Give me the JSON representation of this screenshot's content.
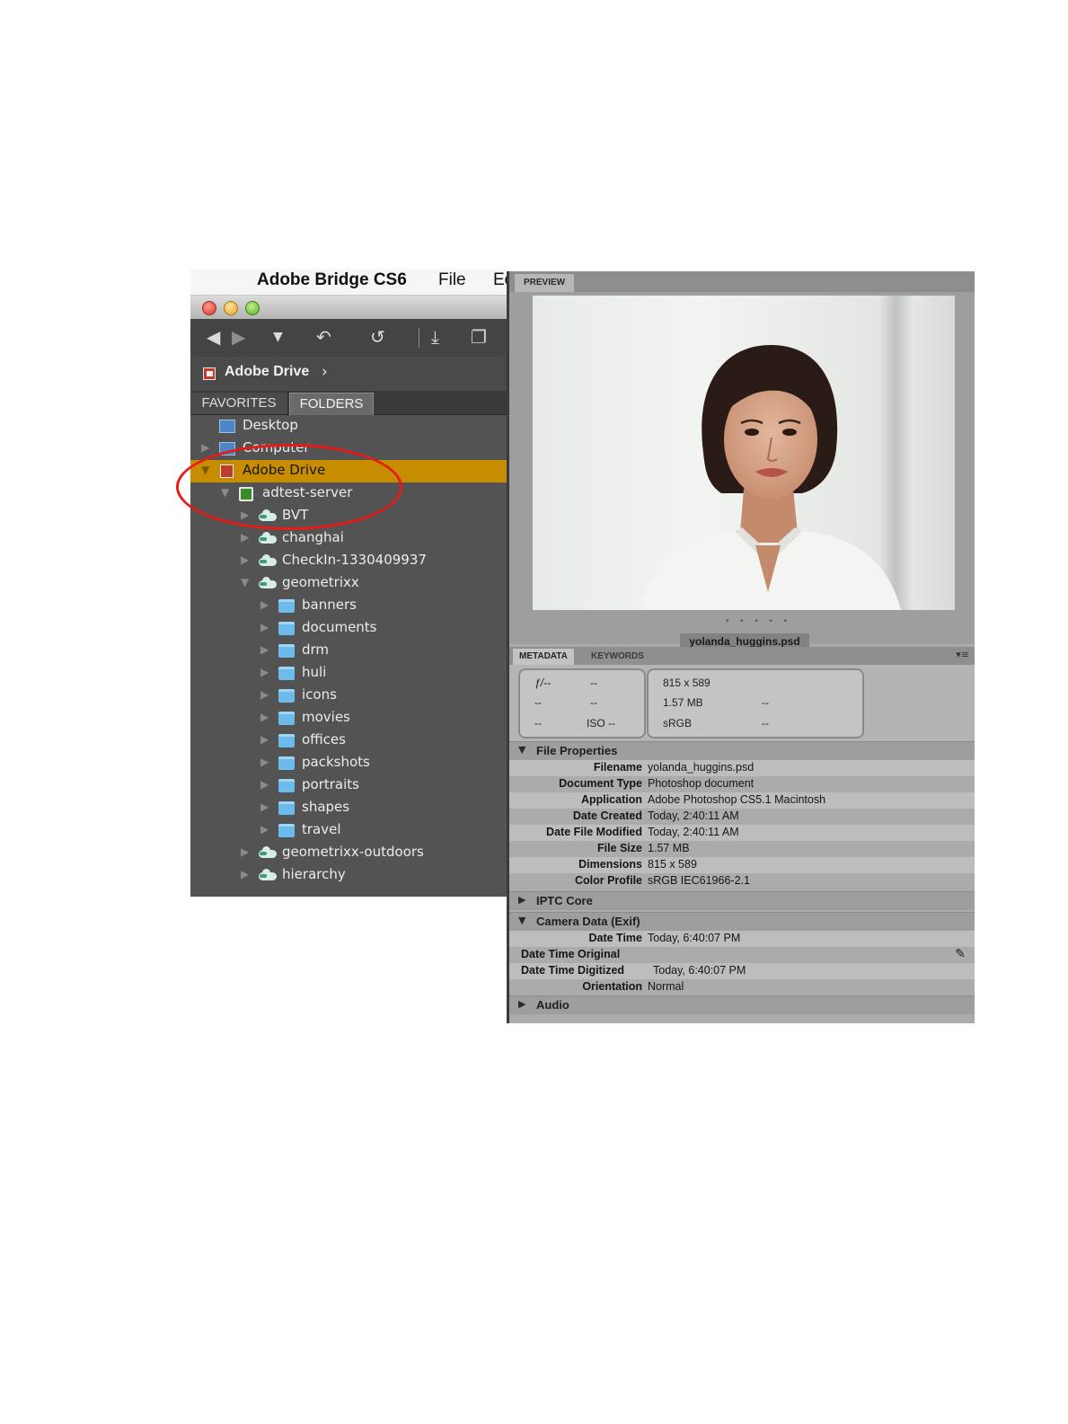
{
  "menubar": {
    "app_name": "Adobe Bridge CS6",
    "file": "File",
    "edit": "Ed"
  },
  "toolbar": {
    "back": "◀",
    "forward": "▶",
    "dropdown": "▼",
    "boomerang": "↶",
    "rotate": "↺",
    "camera": "⤓",
    "copy": "❐"
  },
  "path": {
    "label": "Adobe Drive",
    "chevron": "›"
  },
  "tabs": {
    "favorites": "FAVORITES",
    "folders": "FOLDERS"
  },
  "tree": [
    {
      "label": "Desktop"
    },
    {
      "label": "Computer"
    },
    {
      "label": "Adobe Drive"
    },
    {
      "label": "adtest-server"
    },
    {
      "label": "BVT"
    },
    {
      "label": "changhai"
    },
    {
      "label": "CheckIn-1330409937"
    },
    {
      "label": "geometrixx"
    },
    {
      "label": "banners"
    },
    {
      "label": "documents"
    },
    {
      "label": "drm"
    },
    {
      "label": "huli"
    },
    {
      "label": "icons"
    },
    {
      "label": "movies"
    },
    {
      "label": "offices"
    },
    {
      "label": "packshots"
    },
    {
      "label": "portraits"
    },
    {
      "label": "shapes"
    },
    {
      "label": "travel"
    },
    {
      "label": "geometrixx-outdoors"
    },
    {
      "label": "hierarchy"
    }
  ],
  "preview": {
    "tab": "PREVIEW",
    "filename": "yolanda_huggins.psd",
    "grip": "• • • • •"
  },
  "metadata_tabs": {
    "metadata": "METADATA",
    "keywords": "KEYWORDS",
    "menu": "▾≡"
  },
  "summary": {
    "aperture": "ƒ/--",
    "shutter": "--",
    "r2c1": "--",
    "r2c2": "--",
    "r3c1": "--",
    "iso": "ISO --",
    "dimensions": "815 x 589",
    "size": "1.57 MB",
    "size_extra": "--",
    "profile": "sRGB",
    "profile_extra": "--"
  },
  "sections": {
    "file_properties": "File Properties",
    "iptc_core": "IPTC Core",
    "camera_data": "Camera Data (Exif)",
    "audio": "Audio"
  },
  "file_properties": [
    {
      "key": "Filename",
      "value": "yolanda_huggins.psd"
    },
    {
      "key": "Document Type",
      "value": "Photoshop document"
    },
    {
      "key": "Application",
      "value": "Adobe Photoshop CS5.1 Macintosh"
    },
    {
      "key": "Date Created",
      "value": "Today, 2:40:11 AM"
    },
    {
      "key": "Date File Modified",
      "value": "Today, 2:40:11 AM"
    },
    {
      "key": "File Size",
      "value": "1.57 MB"
    },
    {
      "key": "Dimensions",
      "value": "815 x 589"
    },
    {
      "key": "Color Profile",
      "value": "sRGB IEC61966-2.1"
    }
  ],
  "camera_data": [
    {
      "key": "Date Time",
      "value": "Today, 6:40:07 PM"
    },
    {
      "key": "Date Time Original",
      "value": ""
    },
    {
      "key": "Date Time Digitized",
      "value": "Today, 6:40:07 PM"
    },
    {
      "key": "Orientation",
      "value": "Normal"
    }
  ],
  "colors": {
    "selection": "#c88c00",
    "annotation_circle": "#e41b17",
    "panel_dark": "#535353",
    "panel_light": "#ababab"
  }
}
